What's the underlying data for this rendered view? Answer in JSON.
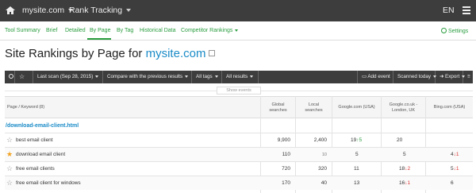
{
  "topbar": {
    "site": "mysite.com",
    "product": "Rank Tracking",
    "language": "EN"
  },
  "tabs": [
    {
      "label": "Tool Summary"
    },
    {
      "label": "Brief"
    },
    {
      "label": "Detailed"
    },
    {
      "label": "By Page",
      "active": true
    },
    {
      "label": "By Tag"
    },
    {
      "label": "Historical Data"
    },
    {
      "label": "Competitor Rankings"
    }
  ],
  "settings_label": "Settings",
  "title": {
    "prefix": "Site Rankings by Page for",
    "site": "mysite.com"
  },
  "toolbar": {
    "last_scan": "Last scan (Sep 28, 2015)",
    "compare": "Compare with the previous results",
    "tags": "All tags",
    "results": "All results",
    "add_event": "Add event",
    "scanned": "Scanned today",
    "export": "Export"
  },
  "show_events": "Show events",
  "table": {
    "headers": {
      "keyword": "Page / Keyword (8)",
      "global": "Global\nsearches",
      "local": "Local\nsearches",
      "google_us": "Google.com (USA)",
      "google_uk": "Google.co.uk -\nLondon, UK",
      "bing": "Bing.com (USA)"
    },
    "group": "/download-email-client.html",
    "rows": [
      {
        "keyword": "best email client",
        "starred": false,
        "global": "9,900",
        "local": "2,400",
        "local_small": false,
        "g_us": "19",
        "g_us_change": "5",
        "g_us_dir": "up",
        "g_uk": "20",
        "g_uk_change": "",
        "g_uk_dir": "",
        "bing": "",
        "bing_change": "",
        "bing_dir": ""
      },
      {
        "keyword": "download email client",
        "starred": true,
        "global": "110",
        "local": "10",
        "local_small": true,
        "g_us": "5",
        "g_us_change": "",
        "g_us_dir": "",
        "g_uk": "5",
        "g_uk_change": "",
        "g_uk_dir": "",
        "bing": "4",
        "bing_change": "1",
        "bing_dir": "down"
      },
      {
        "keyword": "free email clients",
        "starred": false,
        "global": "720",
        "local": "320",
        "local_small": false,
        "g_us": "11",
        "g_us_change": "",
        "g_us_dir": "",
        "g_uk": "18",
        "g_uk_change": "2",
        "g_uk_dir": "down",
        "bing": "5",
        "bing_change": "1",
        "bing_dir": "down"
      },
      {
        "keyword": "free email client for windows",
        "starred": false,
        "global": "170",
        "local": "40",
        "local_small": false,
        "g_us": "13",
        "g_us_change": "",
        "g_us_dir": "",
        "g_uk": "16",
        "g_uk_change": "1",
        "g_uk_dir": "down",
        "bing": "6",
        "bing_change": "",
        "bing_dir": ""
      }
    ]
  },
  "colors": {
    "accent": "#2a9d3f",
    "link": "#1a8bc7",
    "up": "#2a9d3f",
    "down": "#d8322e",
    "star_on": "#f2a11e",
    "nav_bg": "#3d3d3d"
  }
}
